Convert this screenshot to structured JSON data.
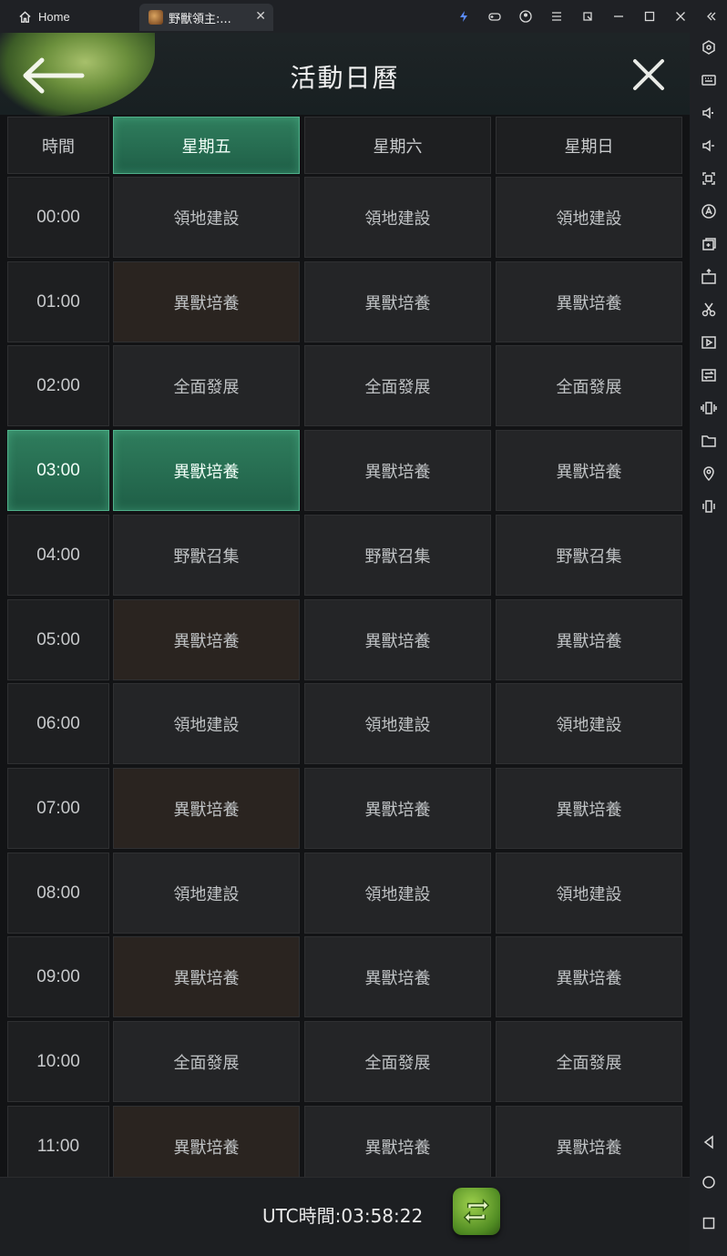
{
  "titlebar": {
    "home_label": "Home",
    "game_tab_label": "野獸領主:...",
    "icons": [
      "bolt-icon",
      "gamepad-icon",
      "account-icon",
      "menu-icon",
      "restore-down-icon",
      "minimize-icon",
      "maximize-icon",
      "close-icon",
      "collapse-sidebar-icon"
    ]
  },
  "sidebar": {
    "icons": [
      "settings-icon",
      "keyboard-icon",
      "volume-up-icon",
      "volume-down-icon",
      "screenshot-icon",
      "macro-icon",
      "multi-instance-icon",
      "apk-install-icon",
      "cut-icon",
      "media-icon",
      "sync-icon",
      "shake-icon",
      "folder-icon",
      "location-icon",
      "rotate-icon",
      "back-nav-icon",
      "home-nav-icon",
      "recents-nav-icon"
    ]
  },
  "header": {
    "title": "活動日曆"
  },
  "table": {
    "col_headers": [
      "時間",
      "星期五",
      "星期六",
      "星期日"
    ],
    "active_column": 1,
    "active_row": 3,
    "rows": [
      {
        "time": "00:00",
        "fri": "領地建設",
        "sat": "領地建設",
        "sun": "領地建設"
      },
      {
        "time": "01:00",
        "fri": "異獸培養",
        "sat": "異獸培養",
        "sun": "異獸培養"
      },
      {
        "time": "02:00",
        "fri": "全面發展",
        "sat": "全面發展",
        "sun": "全面發展"
      },
      {
        "time": "03:00",
        "fri": "異獸培養",
        "sat": "異獸培養",
        "sun": "異獸培養"
      },
      {
        "time": "04:00",
        "fri": "野獸召集",
        "sat": "野獸召集",
        "sun": "野獸召集"
      },
      {
        "time": "05:00",
        "fri": "異獸培養",
        "sat": "異獸培養",
        "sun": "異獸培養"
      },
      {
        "time": "06:00",
        "fri": "領地建設",
        "sat": "領地建設",
        "sun": "領地建設"
      },
      {
        "time": "07:00",
        "fri": "異獸培養",
        "sat": "異獸培養",
        "sun": "異獸培養"
      },
      {
        "time": "08:00",
        "fri": "領地建設",
        "sat": "領地建設",
        "sun": "領地建設"
      },
      {
        "time": "09:00",
        "fri": "異獸培養",
        "sat": "異獸培養",
        "sun": "異獸培養"
      },
      {
        "time": "10:00",
        "fri": "全面發展",
        "sat": "全面發展",
        "sun": "全面發展"
      },
      {
        "time": "11:00",
        "fri": "異獸培養",
        "sat": "異獸培養",
        "sun": "異獸培養"
      }
    ]
  },
  "footer": {
    "utc_text": "UTC時間:03:58:22"
  },
  "colors": {
    "active_green": "#2f7d5d",
    "cell_bg": "#242527",
    "highlight_brown": "#2a2420",
    "accent_leaf": "#6b8f3c"
  }
}
